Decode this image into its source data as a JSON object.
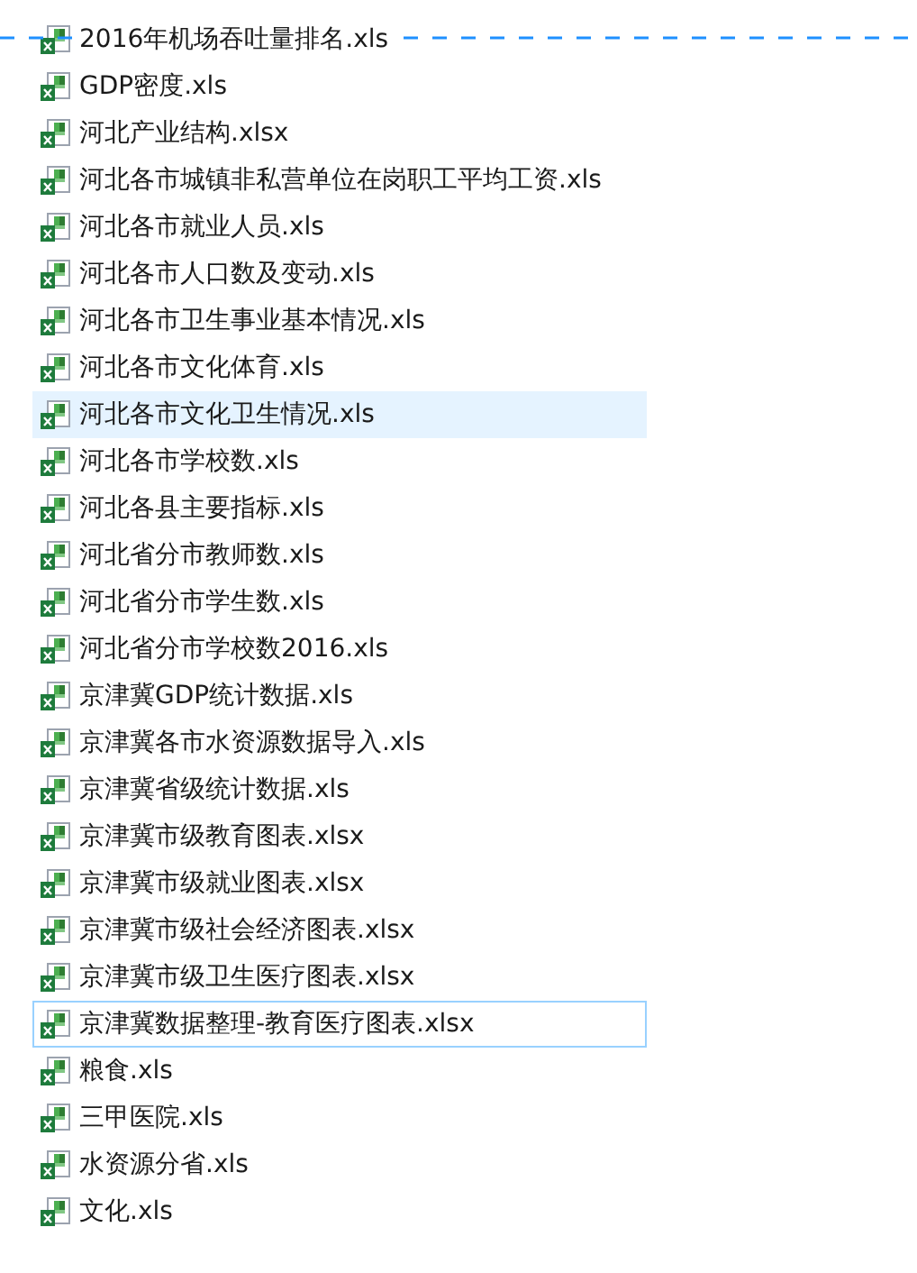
{
  "files": [
    {
      "name": "2016年机场吞吐量排名.xls",
      "hovered": false,
      "focused": false
    },
    {
      "name": "GDP密度.xls",
      "hovered": false,
      "focused": false
    },
    {
      "name": "河北产业结构.xlsx",
      "hovered": false,
      "focused": false
    },
    {
      "name": "河北各市城镇非私营单位在岗职工平均工资.xls",
      "hovered": false,
      "focused": false
    },
    {
      "name": "河北各市就业人员.xls",
      "hovered": false,
      "focused": false
    },
    {
      "name": "河北各市人口数及变动.xls",
      "hovered": false,
      "focused": false
    },
    {
      "name": "河北各市卫生事业基本情况.xls",
      "hovered": false,
      "focused": false
    },
    {
      "name": "河北各市文化体育.xls",
      "hovered": false,
      "focused": false
    },
    {
      "name": "河北各市文化卫生情况.xls",
      "hovered": true,
      "focused": false
    },
    {
      "name": "河北各市学校数.xls",
      "hovered": false,
      "focused": false
    },
    {
      "name": "河北各县主要指标.xls",
      "hovered": false,
      "focused": false
    },
    {
      "name": "河北省分市教师数.xls",
      "hovered": false,
      "focused": false
    },
    {
      "name": "河北省分市学生数.xls",
      "hovered": false,
      "focused": false
    },
    {
      "name": "河北省分市学校数2016.xls",
      "hovered": false,
      "focused": false
    },
    {
      "name": "京津冀GDP统计数据.xls",
      "hovered": false,
      "focused": false
    },
    {
      "name": "京津冀各市水资源数据导入.xls",
      "hovered": false,
      "focused": false
    },
    {
      "name": "京津冀省级统计数据.xls",
      "hovered": false,
      "focused": false
    },
    {
      "name": "京津冀市级教育图表.xlsx",
      "hovered": false,
      "focused": false
    },
    {
      "name": "京津冀市级就业图表.xlsx",
      "hovered": false,
      "focused": false
    },
    {
      "name": "京津冀市级社会经济图表.xlsx",
      "hovered": false,
      "focused": false
    },
    {
      "name": "京津冀市级卫生医疗图表.xlsx",
      "hovered": false,
      "focused": false
    },
    {
      "name": "京津冀数据整理-教育医疗图表.xlsx",
      "hovered": false,
      "focused": true
    },
    {
      "name": "粮食.xls",
      "hovered": false,
      "focused": false
    },
    {
      "name": "三甲医院.xls",
      "hovered": false,
      "focused": false
    },
    {
      "name": "水资源分省.xls",
      "hovered": false,
      "focused": false
    },
    {
      "name": "文化.xls",
      "hovered": false,
      "focused": false
    }
  ]
}
